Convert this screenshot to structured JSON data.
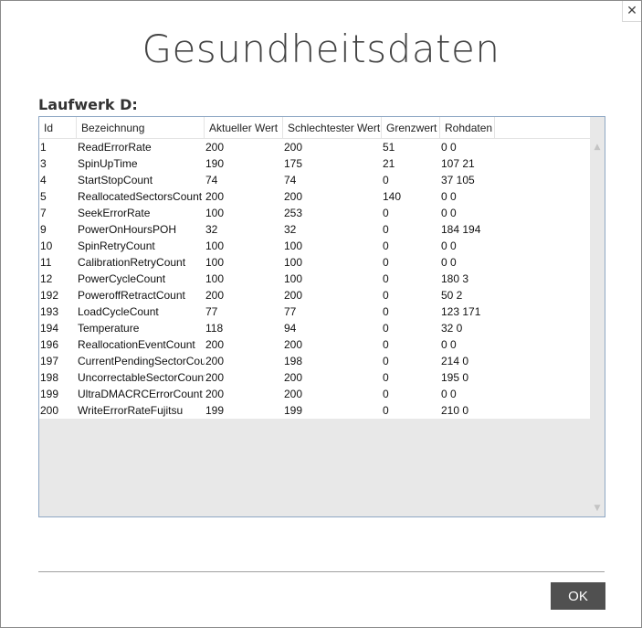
{
  "window": {
    "title": "Gesundheitsdaten",
    "close_label": "✕"
  },
  "drive_label": "Laufwerk D:",
  "table": {
    "columns": [
      "Id",
      "Bezeichnung",
      "Aktueller Wert",
      "Schlechtester Wert",
      "Grenzwert",
      "Rohdaten"
    ],
    "rows": [
      [
        "1",
        "ReadErrorRate",
        "200",
        "200",
        "51",
        "0 0"
      ],
      [
        "3",
        "SpinUpTime",
        "190",
        "175",
        "21",
        "107 21"
      ],
      [
        "4",
        "StartStopCount",
        "74",
        "74",
        "0",
        "37 105"
      ],
      [
        "5",
        "ReallocatedSectorsCount",
        "200",
        "200",
        "140",
        "0 0"
      ],
      [
        "7",
        "SeekErrorRate",
        "100",
        "253",
        "0",
        "0 0"
      ],
      [
        "9",
        "PowerOnHoursPOH",
        "32",
        "32",
        "0",
        "184 194"
      ],
      [
        "10",
        "SpinRetryCount",
        "100",
        "100",
        "0",
        "0 0"
      ],
      [
        "11",
        "CalibrationRetryCount",
        "100",
        "100",
        "0",
        "0 0"
      ],
      [
        "12",
        "PowerCycleCount",
        "100",
        "100",
        "0",
        "180 3"
      ],
      [
        "192",
        "PoweroffRetractCount",
        "200",
        "200",
        "0",
        "50 2"
      ],
      [
        "193",
        "LoadCycleCount",
        "77",
        "77",
        "0",
        "123 171"
      ],
      [
        "194",
        "Temperature",
        "118",
        "94",
        "0",
        "32 0"
      ],
      [
        "196",
        "ReallocationEventCount",
        "200",
        "200",
        "0",
        "0 0"
      ],
      [
        "197",
        "CurrentPendingSectorCou",
        "200",
        "198",
        "0",
        "214 0"
      ],
      [
        "198",
        "UncorrectableSectorCount",
        "200",
        "200",
        "0",
        "195 0"
      ],
      [
        "199",
        "UltraDMACRCErrorCount",
        "200",
        "200",
        "0",
        "0 0"
      ],
      [
        "200",
        "WriteErrorRateFujitsu",
        "199",
        "199",
        "0",
        "210 0"
      ]
    ]
  },
  "buttons": {
    "ok_label": "OK"
  }
}
